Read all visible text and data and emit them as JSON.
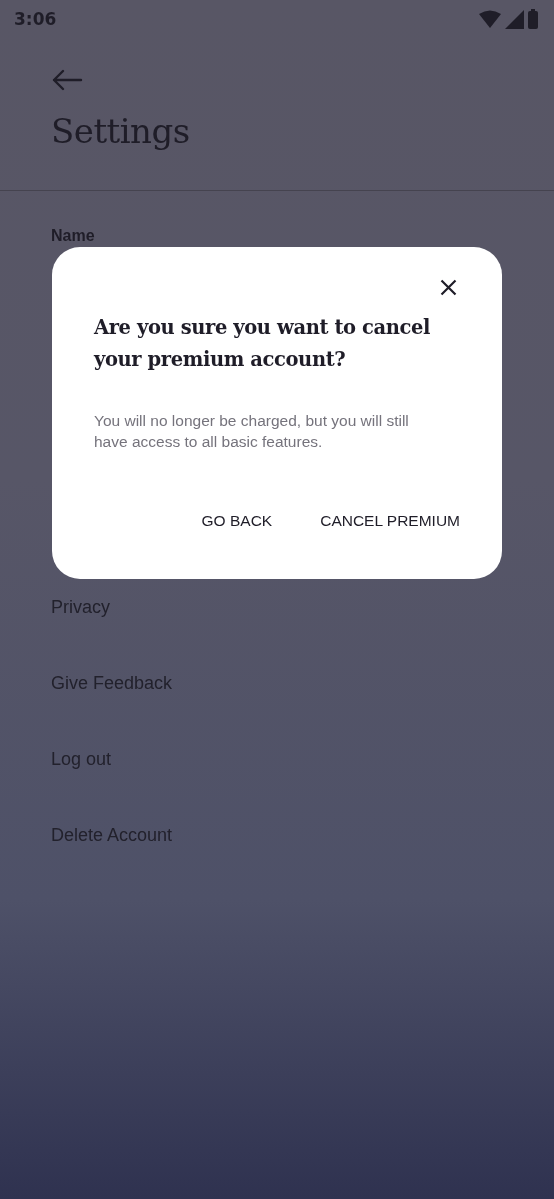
{
  "status_bar": {
    "time": "3:06"
  },
  "header": {
    "title": "Settings"
  },
  "settings": [
    {
      "label": "Name",
      "kind": "heading"
    },
    {
      "label": "Privacy",
      "kind": "link"
    },
    {
      "label": "Give Feedback",
      "kind": "link"
    },
    {
      "label": "Log out",
      "kind": "link"
    },
    {
      "label": "Delete Account",
      "kind": "link"
    }
  ],
  "dialog": {
    "title": "Are you sure you want to cancel your premium account?",
    "message": "You will no longer be charged, but you will still have access to all basic features.",
    "buttons": [
      "GO BACK",
      "CANCEL PREMIUM"
    ]
  }
}
